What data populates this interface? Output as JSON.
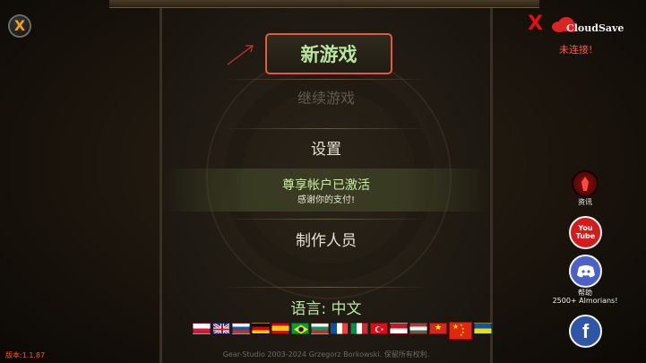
{
  "window": {
    "close_glyph": "X"
  },
  "menu": {
    "new_game": "新游戏",
    "continue": "继续游戏",
    "settings": "设置",
    "account_title": "尊享帐户已激活",
    "account_subtitle": "感谢你的支付!",
    "credits": "制作人员",
    "language": "语言: 中文"
  },
  "cloud": {
    "x_glyph": "X",
    "title": "CloudSave",
    "status": "未连接!"
  },
  "side": {
    "news_label": "资讯",
    "help_label": "帮助",
    "almorians_label": "2500+ Almorians!",
    "youtube_text": "You Tube",
    "facebook_text": "f"
  },
  "flags": [
    "pl",
    "gb",
    "ru",
    "de",
    "es",
    "br",
    "bg",
    "fr",
    "it",
    "tr",
    "id",
    "hu",
    "vn",
    "cn",
    "ua"
  ],
  "selected_flag": "cn",
  "footer": "Gear-Studio 2003-2024 Grzegorz Borkowski. 保留所有权利.",
  "version": "版本:1.1.87",
  "colors": {
    "highlight_border": "#e25a3a",
    "active_text": "#b8e6a0",
    "disabled_text": "#5e5a4e",
    "version_text": "#ff5a00",
    "cloud_x": "#e01010",
    "status_text": "#ff5a3a"
  }
}
